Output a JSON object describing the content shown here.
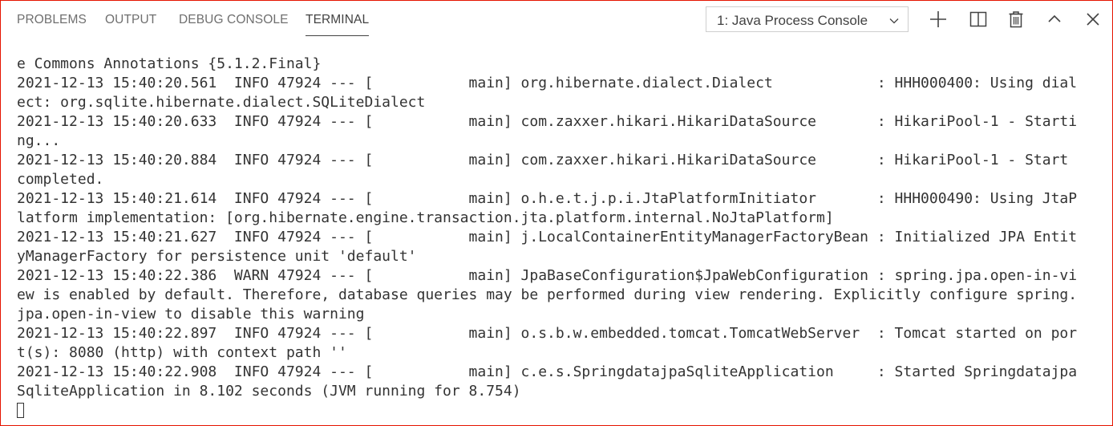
{
  "tabs": [
    {
      "label": "PROBLEMS",
      "active": false
    },
    {
      "label": "OUTPUT",
      "active": false
    },
    {
      "label": "DEBUG CONSOLE",
      "active": false
    },
    {
      "label": "TERMINAL",
      "active": true
    }
  ],
  "terminal_selector": {
    "selected": "1: Java Process Console"
  },
  "actions": [
    "plus-icon",
    "split-icon",
    "trash-icon",
    "chevron-up-icon",
    "close-icon"
  ],
  "terminal": {
    "lines": [
      "e Commons Annotations {5.1.2.Final}",
      "2021-12-13 15:40:20.561  INFO 47924 --- [           main] org.hibernate.dialect.Dialect            : HHH000400: Using dial",
      "ect: org.sqlite.hibernate.dialect.SQLiteDialect",
      "2021-12-13 15:40:20.633  INFO 47924 --- [           main] com.zaxxer.hikari.HikariDataSource       : HikariPool-1 - Starti",
      "ng...",
      "2021-12-13 15:40:20.884  INFO 47924 --- [           main] com.zaxxer.hikari.HikariDataSource       : HikariPool-1 - Start",
      "completed.",
      "2021-12-13 15:40:21.614  INFO 47924 --- [           main] o.h.e.t.j.p.i.JtaPlatformInitiator       : HHH000490: Using JtaP",
      "latform implementation: [org.hibernate.engine.transaction.jta.platform.internal.NoJtaPlatform]",
      "2021-12-13 15:40:21.627  INFO 47924 --- [           main] j.LocalContainerEntityManagerFactoryBean : Initialized JPA Entit",
      "yManagerFactory for persistence unit 'default'",
      "2021-12-13 15:40:22.386  WARN 47924 --- [           main] JpaBaseConfiguration$JpaWebConfiguration : spring.jpa.open-in-vi",
      "ew is enabled by default. Therefore, database queries may be performed during view rendering. Explicitly configure spring.",
      "jpa.open-in-view to disable this warning",
      "2021-12-13 15:40:22.897  INFO 47924 --- [           main] o.s.b.w.embedded.tomcat.TomcatWebServer  : Tomcat started on por",
      "t(s): 8080 (http) with context path ''",
      "2021-12-13 15:40:22.908  INFO 47924 --- [           main] c.e.s.SpringdatajpaSqliteApplication     : Started Springdatajpa",
      "SqliteApplication in 8.102 seconds (JVM running for 8.754)"
    ]
  },
  "colors": {
    "frame_border": "#e51400",
    "text": "#333333",
    "tab_inactive": "#6f6f6f",
    "tab_active": "#424242"
  }
}
